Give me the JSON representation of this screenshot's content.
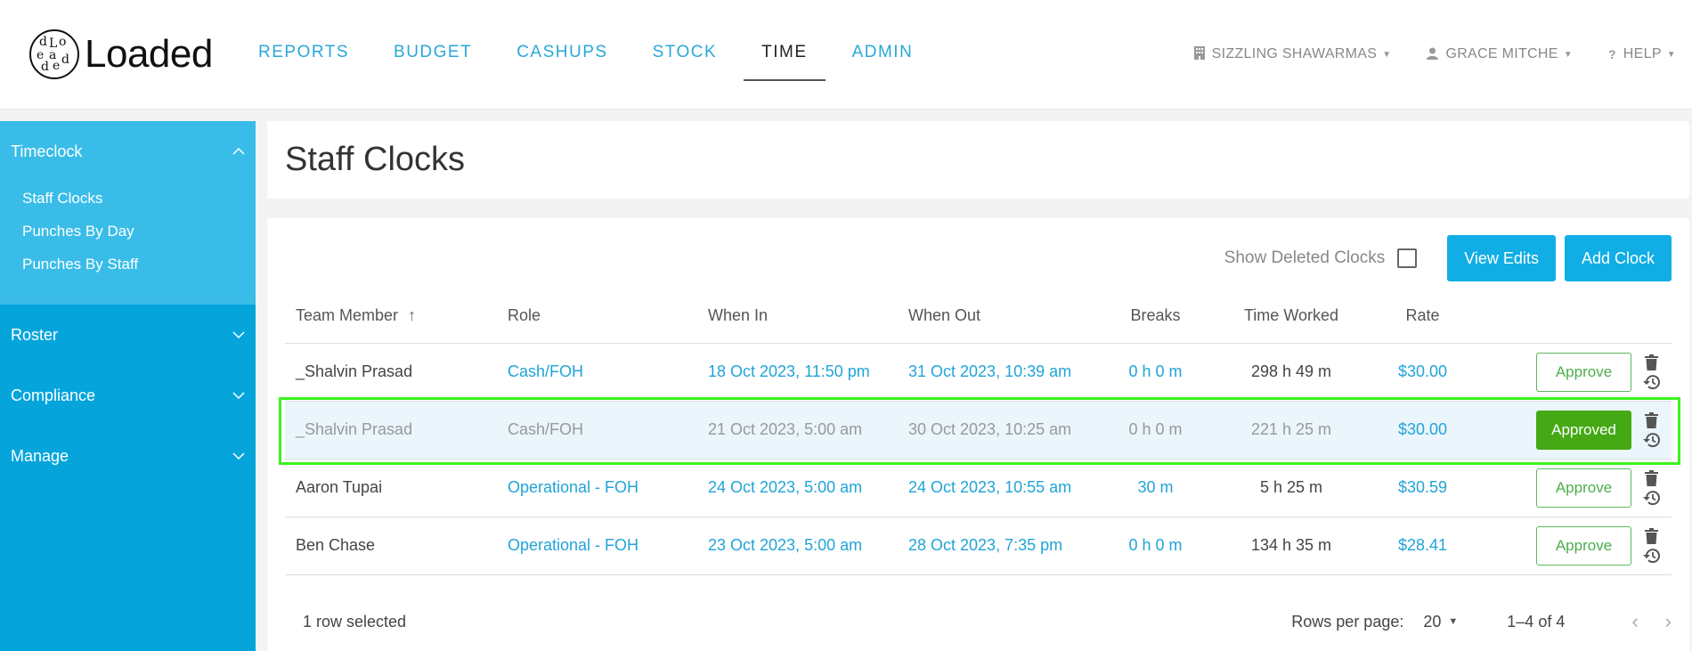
{
  "brand": {
    "name": "Loaded",
    "emblem": "Loaded"
  },
  "nav": {
    "items": [
      "REPORTS",
      "BUDGET",
      "CASHUPS",
      "STOCK",
      "TIME",
      "ADMIN"
    ],
    "active": "TIME"
  },
  "topright": {
    "store": "SIZZLING SHAWARMAS",
    "user": "GRACE MITCHE",
    "help": "HELP"
  },
  "sidebar": {
    "timeclock": "Timeclock",
    "sub": [
      "Staff Clocks",
      "Punches By Day",
      "Punches By Staff"
    ],
    "roster": "Roster",
    "compliance": "Compliance",
    "manage": "Manage"
  },
  "page": {
    "title": "Staff Clocks"
  },
  "toolbar": {
    "show_deleted": "Show Deleted Clocks",
    "view_edits": "View Edits",
    "add_clock": "Add Clock"
  },
  "table": {
    "headers": [
      "Team Member",
      "Role",
      "When In",
      "When Out",
      "Breaks",
      "Time Worked",
      "Rate"
    ],
    "sort_icon": "↑",
    "rows": [
      {
        "member": "_Shalvin Prasad",
        "role": "Cash/FOH",
        "in": "18 Oct 2023, 11:50 pm",
        "out": "31 Oct 2023, 10:39 am",
        "breaks": "0 h 0 m",
        "worked": "298 h 49 m",
        "rate": "$30.00",
        "action": "Approve"
      },
      {
        "member": "_Shalvin Prasad",
        "role": "Cash/FOH",
        "in": "21 Oct 2023, 5:00 am",
        "out": "30 Oct 2023, 10:25 am",
        "breaks": "0 h 0 m",
        "worked": "221 h 25 m",
        "rate": "$30.00",
        "action": "Approved"
      },
      {
        "member": "Aaron Tupai",
        "role": "Operational - FOH",
        "in": "24 Oct 2023, 5:00 am",
        "out": "24 Oct 2023, 10:55 am",
        "breaks": "30 m",
        "worked": "5 h 25 m",
        "rate": "$30.59",
        "action": "Approve"
      },
      {
        "member": "Ben Chase",
        "role": "Operational - FOH",
        "in": "23 Oct 2023, 5:00 am",
        "out": "28 Oct 2023, 7:35 pm",
        "breaks": "0 h 0 m",
        "worked": "134 h 35 m",
        "rate": "$28.41",
        "action": "Approve"
      }
    ]
  },
  "footer": {
    "selected": "1 row selected",
    "rows_per_page_label": "Rows per page:",
    "rows_per_page": "20",
    "range": "1–4 of 4"
  },
  "colors": {
    "accent": "#10aee5",
    "approved": "#44a914",
    "highlight": "#3cf31e"
  }
}
